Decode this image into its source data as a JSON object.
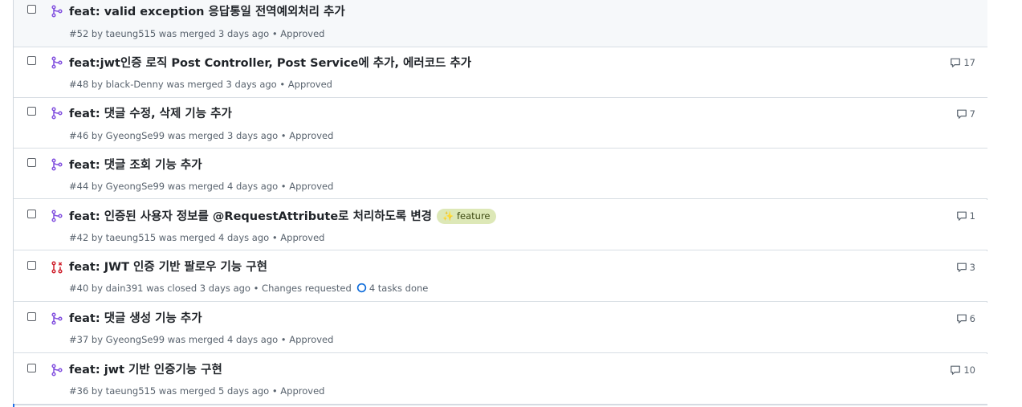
{
  "pull_requests": [
    {
      "title": "feat: valid exception 응답통일 전역예외처리 추가",
      "meta": "#52 by taeung515 was merged 3 days ago • Approved",
      "status": "merged",
      "comments": "",
      "label": ""
    },
    {
      "title": "feat:jwt인증 로직 Post Controller, Post Service에 추가, 에러코드 추가",
      "meta": "#48 by black-Denny was merged 3 days ago • Approved",
      "status": "merged",
      "comments": "17",
      "label": ""
    },
    {
      "title": "feat: 댓글 수정, 삭제 기능 추가",
      "meta": "#46 by GyeongSe99 was merged 3 days ago • Approved",
      "status": "merged",
      "comments": "7",
      "label": ""
    },
    {
      "title": "feat: 댓글 조회 기능 추가",
      "meta": "#44 by GyeongSe99 was merged 4 days ago • Approved",
      "status": "merged",
      "comments": "",
      "label": ""
    },
    {
      "title": "feat: 인증된 사용자 정보를 @RequestAttribute로 처리하도록 변경",
      "meta": "#42 by taeung515 was merged 4 days ago • Approved",
      "status": "merged",
      "comments": "1",
      "label": "✨ feature"
    },
    {
      "title": "feat: JWT 인증 기반 팔로우 기능 구현",
      "meta": "#40 by dain391 was closed 3 days ago • Changes requested",
      "status": "closed",
      "comments": "3",
      "label": "",
      "tasks": "4 tasks done"
    },
    {
      "title": "feat: 댓글 생성 기능 추가",
      "meta": "#37 by GyeongSe99 was merged 4 days ago • Approved",
      "status": "merged",
      "comments": "6",
      "label": ""
    },
    {
      "title": "feat: jwt 기반 인증기능 구현",
      "meta": "#36 by taeung515 was merged 5 days ago • Approved",
      "status": "merged",
      "comments": "10",
      "label": ""
    }
  ],
  "colors": {
    "merged": "#8250df",
    "closed": "#cf222e",
    "label_bg": "#dde8b7",
    "task_ring": "#0969da"
  },
  "icons": {
    "merged": "git-merge-icon",
    "closed": "git-pull-request-closed-icon",
    "comments": "comment-icon",
    "task": "task-progress-icon"
  }
}
